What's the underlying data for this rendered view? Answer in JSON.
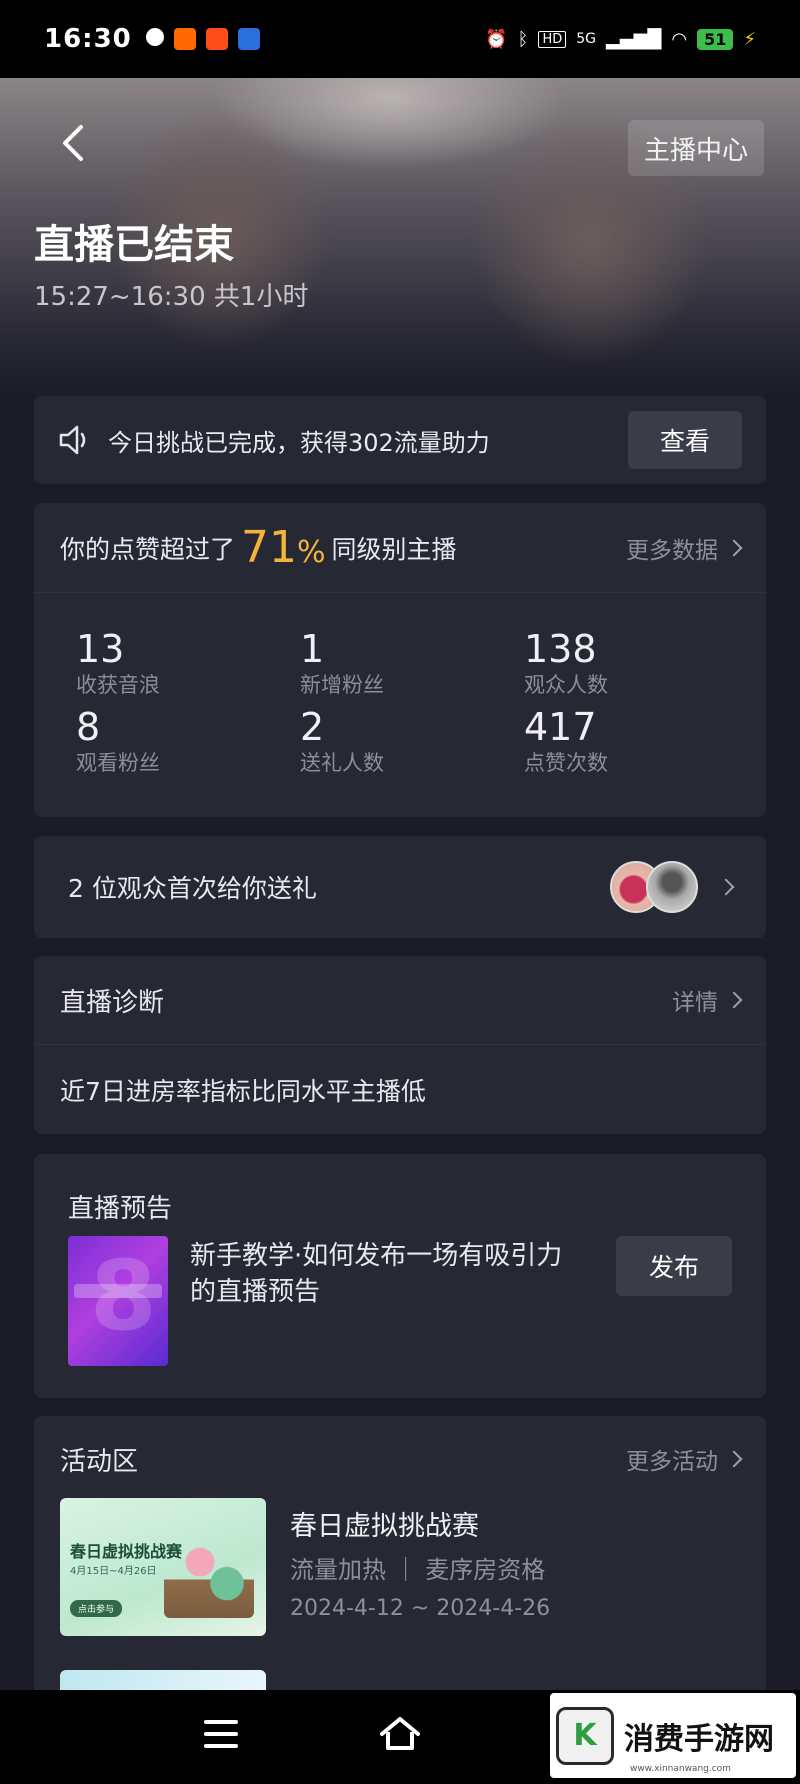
{
  "status_bar": {
    "time": "16:30",
    "battery": "51",
    "network": "5G",
    "hd": "HD"
  },
  "header": {
    "back_icon": "chevron-left-icon",
    "anchor_center_label": "主播中心",
    "title": "直播已结束",
    "time_range": "15:27~16:30 共1小时"
  },
  "challenge": {
    "icon": "speaker-icon",
    "text": "今日挑战已完成，获得302流量助力",
    "button": "查看"
  },
  "stats": {
    "intro": "你的点赞超过了",
    "percent": "71",
    "percent_sign": "%",
    "suffix": "同级别主播",
    "more_label": "更多数据",
    "items": [
      {
        "value": "13",
        "label": "收获音浪"
      },
      {
        "value": "1",
        "label": "新增粉丝"
      },
      {
        "value": "138",
        "label": "观众人数"
      },
      {
        "value": "8",
        "label": "观看粉丝"
      },
      {
        "value": "2",
        "label": "送礼人数"
      },
      {
        "value": "417",
        "label": "点赞次数"
      }
    ]
  },
  "gift": {
    "text": "2 位观众首次给你送礼"
  },
  "diagnosis": {
    "title": "直播诊断",
    "more_label": "详情",
    "body": "近7日进房率指标比同水平主播低"
  },
  "preview": {
    "title": "直播预告",
    "description": "新手教学·如何发布一场有吸引力的直播预告",
    "button": "发布"
  },
  "activity": {
    "title": "活动区",
    "more_label": "更多活动",
    "items": [
      {
        "name": "春日虚拟挑战赛",
        "tags": "流量加热 ｜ 麦序房资格",
        "date": "2024-4-12 ~ 2024-4-26",
        "thumb_title": "春日虚拟挑战赛",
        "thumb_date": "4月15日~4月26日",
        "thumb_button": "点击参与"
      }
    ]
  },
  "watermark": {
    "name": "消费手游网",
    "url": "www.xinnanwang.com"
  },
  "colors": {
    "accent": "#f4b33c",
    "card": "#262834",
    "background": "#1b1c26"
  }
}
